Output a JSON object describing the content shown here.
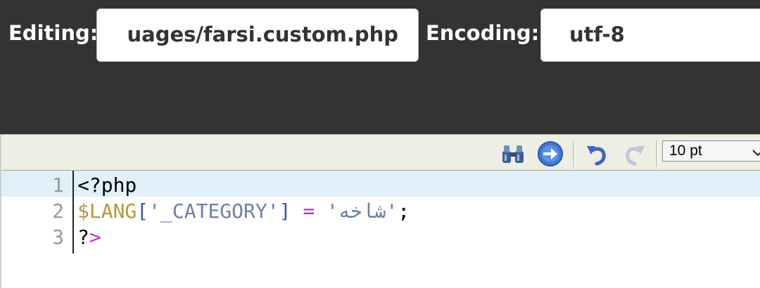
{
  "header": {
    "editing_label": "Editing:",
    "editing_value": "uages/farsi.custom.php",
    "encoding_label": "Encoding:",
    "encoding_value": "utf-8"
  },
  "toolbar": {
    "font_size": "10 pt",
    "icons": [
      "binoculars-icon",
      "goto-arrow-icon",
      "undo-icon",
      "redo-icon"
    ]
  },
  "editor": {
    "line_numbers": [
      "1",
      "2",
      "3"
    ],
    "line1": "<?php",
    "line2": {
      "var": "$LANG",
      "open": "[",
      "key": "'_CATEGORY'",
      "close": "]",
      "eq": "=",
      "value": "'شاخه'",
      "semi": ";"
    },
    "line3": {
      "q": "?",
      "gt": ">"
    }
  },
  "colors": {
    "background": "#333333",
    "toolbar": "#eeeee2",
    "active_line": "#e1f0f8",
    "variable": "#b09a3a",
    "string": "#6b7fa8",
    "operator": "#c030c0"
  }
}
